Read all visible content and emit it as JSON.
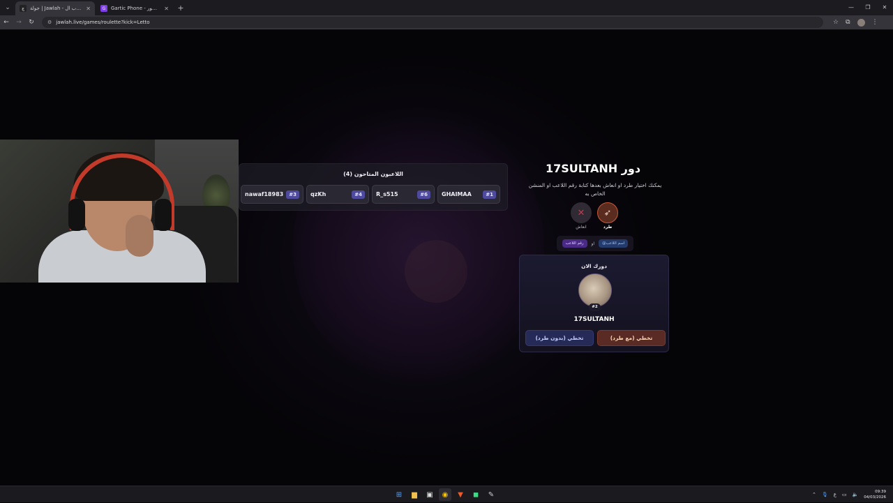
{
  "browser": {
    "tabs": [
      {
        "title": "جولة | Jawlah - منصة الألعاب ال...",
        "favicon": "jawlah-icon",
        "active": true
      },
      {
        "title": "Gartic Phone - الهاتف المكسور",
        "favicon": "gartic-icon",
        "active": false
      }
    ],
    "url": "jawlah.live/games/roulette?kick=Letto"
  },
  "players": {
    "title": "اللاعبون المتاحون (4)",
    "list": [
      {
        "name": "nawaf18983",
        "number": "#3"
      },
      {
        "name": "qzKh",
        "number": "#4"
      },
      {
        "name": "R_s515",
        "number": "#6"
      },
      {
        "name": "GHAIMAA",
        "number": "#1"
      }
    ]
  },
  "turn": {
    "title": "دور 17SULTANH",
    "description": "يمكنك اختيار طرد او انعاش بعدها كتابة رقم اللاعب او المنشن الخاص به",
    "actions": {
      "kick_label": "طرد",
      "revive_label": "انعاش"
    },
    "hint": {
      "mention": "@اسم اللاعب",
      "or": "او",
      "number": "رقم اللاعب"
    }
  },
  "current": {
    "label": "دورك الان",
    "badge": "#2",
    "name": "17SULTANH",
    "skip_with_kick": "تخطي (مع طرد)",
    "skip_without_kick": "تخطي (بدون طرد)"
  },
  "taskbar": {
    "time": "09:39",
    "date": "04/03/2026",
    "lang": "ع"
  },
  "colors": {
    "accent_purple": "#4e4a9e",
    "kick_orange": "#c85a3a",
    "skip_blue": "#252b56"
  }
}
